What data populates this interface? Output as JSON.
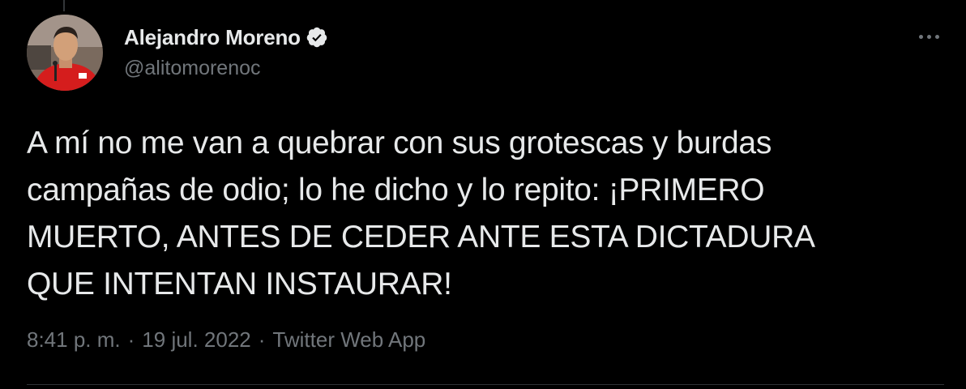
{
  "tweet": {
    "author": {
      "name": "Alejandro Moreno",
      "handle": "@alitomorenoc",
      "verified": true
    },
    "text": "A mí no me van a quebrar con sus grotescas y burdas\ncampañas de odio; lo he dicho y lo repito: ¡PRIMERO\nMUERTO, ANTES DE CEDER ANTE ESTA DICTADURA\nQUE INTENTAN INSTAURAR!",
    "time": "8:41 p. m.",
    "date": "19 jul. 2022",
    "source": "Twitter Web App",
    "separator": "·"
  },
  "icons": {
    "verified": "verified-badge-icon",
    "more": "more-options-icon"
  },
  "colors": {
    "background": "#000000",
    "primary_text": "#e7e9ea",
    "secondary_text": "#71767b",
    "divider": "#2f3336",
    "verified_badge": "#e7e9ea"
  }
}
